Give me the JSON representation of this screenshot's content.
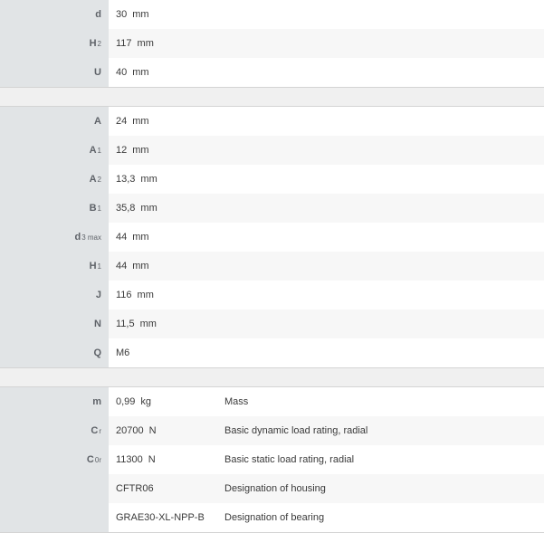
{
  "block1": [
    {
      "sym": "d",
      "sub": "",
      "value": "30",
      "unit": "mm"
    },
    {
      "sym": "H",
      "sub": "2",
      "value": "117",
      "unit": "mm"
    },
    {
      "sym": "U",
      "sub": "",
      "value": "40",
      "unit": "mm"
    }
  ],
  "block2": [
    {
      "sym": "A",
      "sub": "",
      "value": "24",
      "unit": "mm"
    },
    {
      "sym": "A",
      "sub": "1",
      "value": "12",
      "unit": "mm"
    },
    {
      "sym": "A",
      "sub": "2",
      "value": "13,3",
      "unit": "mm"
    },
    {
      "sym": "B",
      "sub": "1",
      "value": "35,8",
      "unit": "mm"
    },
    {
      "sym": "d",
      "sub": "3 max",
      "value": "44",
      "unit": "mm"
    },
    {
      "sym": "H",
      "sub": "1",
      "value": "44",
      "unit": "mm"
    },
    {
      "sym": "J",
      "sub": "",
      "value": "116",
      "unit": "mm"
    },
    {
      "sym": "N",
      "sub": "",
      "value": "11,5",
      "unit": "mm"
    },
    {
      "sym": "Q",
      "sub": "",
      "value": "M6",
      "unit": ""
    }
  ],
  "block3": [
    {
      "sym": "m",
      "sub": "",
      "value": "0,99",
      "unit": "kg",
      "desc": "Mass"
    },
    {
      "sym": "C",
      "sub": "r",
      "value": "20700",
      "unit": "N",
      "desc": "Basic dynamic load rating, radial"
    },
    {
      "sym": "C",
      "sub": "0r",
      "value": "11300",
      "unit": "N",
      "desc": "Basic static load rating, radial"
    },
    {
      "sym": "",
      "sub": "",
      "value": "CFTR06",
      "unit": "",
      "desc": "Designation of housing"
    },
    {
      "sym": "",
      "sub": "",
      "value": "GRAE30-XL-NPP-B",
      "unit": "",
      "desc": "Designation of bearing"
    }
  ]
}
